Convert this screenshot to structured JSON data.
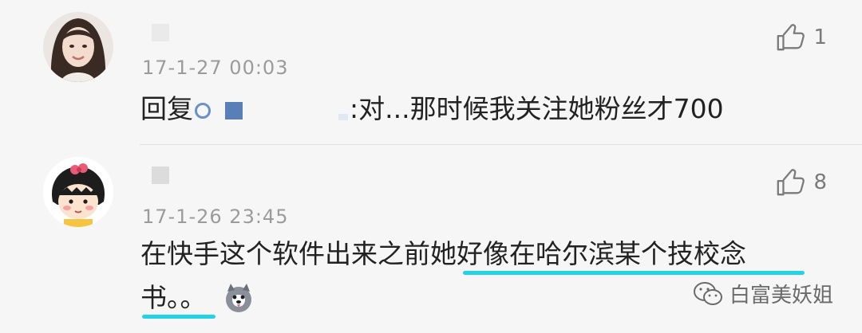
{
  "comments": [
    {
      "timestamp": "17-1-27 00:03",
      "likes": "1",
      "reply_prefix": "回复",
      "text": ":对...那时候我关注她粉丝才700"
    },
    {
      "timestamp": "17-1-26 23:45",
      "likes": "8",
      "text_line1_a": "在快手这个软件出来之前",
      "text_line1_b": "她好像在哈尔滨某个技校念",
      "text_line2": "书。。"
    }
  ],
  "watermark": {
    "label": "白富美妖姐"
  },
  "colors": {
    "underline": "#22d3e6",
    "mention": "#5a7fb8"
  }
}
